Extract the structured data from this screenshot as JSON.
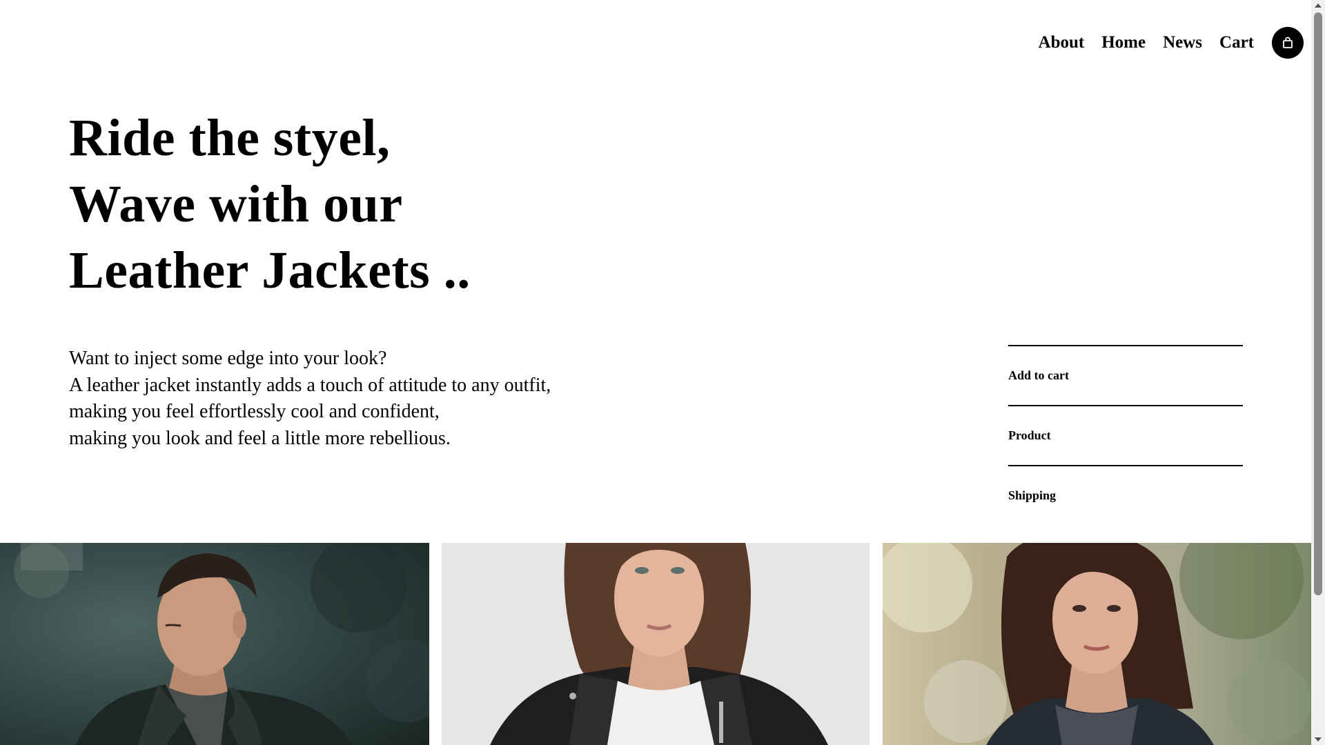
{
  "nav": {
    "items": [
      {
        "label": "About"
      },
      {
        "label": "Home"
      },
      {
        "label": "News"
      },
      {
        "label": "Cart"
      }
    ],
    "cart_icon": "shopping-bag-icon"
  },
  "hero": {
    "title_lines": [
      "Ride the styel,",
      "Wave with our",
      "Leather Jackets .."
    ],
    "description_lines": [
      "Want to inject some edge into your look?",
      "A leather jacket instantly adds a touch of attitude to any outfit,",
      "making you feel effortlessly cool and confident,",
      "making you look and feel a little more rebellious."
    ]
  },
  "side_menu": {
    "items": [
      {
        "label": "Add to cart"
      },
      {
        "label": "Product"
      },
      {
        "label": "Shipping"
      }
    ]
  },
  "colors": {
    "background": "#ffffff",
    "text": "#000000",
    "accent": "#000000"
  }
}
